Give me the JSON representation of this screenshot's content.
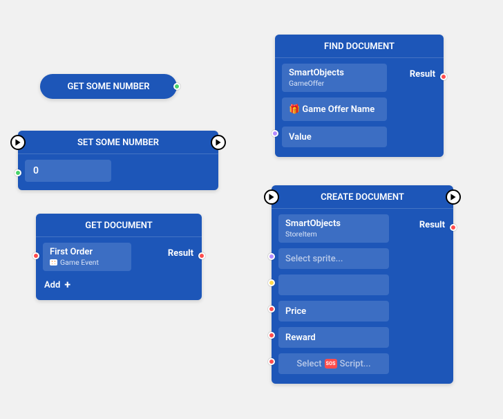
{
  "colors": {
    "node_bg": "#1d56b8",
    "field_bg": "#3c6ec3",
    "canvas_bg": "#f1f1f1",
    "port_green": "#4ad26b",
    "port_red": "#ff4d4d",
    "port_purple": "#b58cff",
    "port_yellow": "#ffd84d",
    "port_orange": "#ff9a4d"
  },
  "nodes": {
    "getNumber": {
      "title": "GET SOME NUMBER"
    },
    "setNumber": {
      "title": "SET SOME NUMBER",
      "value": "0"
    },
    "getDocument": {
      "title": "GET DOCUMENT",
      "field_label": "First Order",
      "field_sub": "Game Event",
      "result_label": "Result",
      "add_label": "Add"
    },
    "findDocument": {
      "title": "FIND DOCUMENT",
      "field1_label": "SmartObjects",
      "field1_sub": "GameOffer",
      "field2_label": "🎁 Game Offer Name",
      "field3_label": "Value",
      "result_label": "Result"
    },
    "createDocument": {
      "title": "CREATE DOCUMENT",
      "field1_label": "SmartObjects",
      "field1_sub": "StoreItem",
      "field2_placeholder": "Select sprite...",
      "field3_label": "",
      "field4_label": "Price",
      "field5_label": "Reward",
      "field6_prefix": "Select",
      "field6_badge": "SOS",
      "field6_suffix": "Script...",
      "result_label": "Result"
    }
  }
}
